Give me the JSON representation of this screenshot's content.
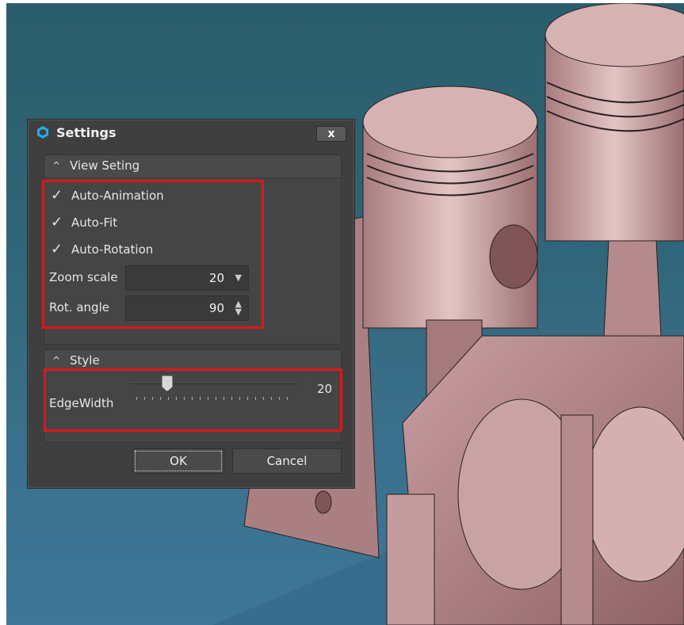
{
  "dialog": {
    "title": "Settings",
    "close_label": "x",
    "view_group": {
      "title": "View Seting",
      "checkboxes": [
        {
          "label": "Auto-Animation",
          "checked": true
        },
        {
          "label": "Auto-Fit",
          "checked": true
        },
        {
          "label": "Auto-Rotation",
          "checked": true
        }
      ],
      "zoom_label": "Zoom scale",
      "zoom_value": "20",
      "rot_label": "Rot. angle",
      "rot_value": "90"
    },
    "style_group": {
      "title": "Style",
      "edge_label": "EdgeWidth",
      "edge_value": "20"
    },
    "ok_label": "OK",
    "cancel_label": "Cancel"
  },
  "icons": {
    "chevron": "chevron-up-icon",
    "check": "checkmark-icon",
    "dropdown": "dropdown-arrow-icon",
    "spinner": "spinner-arrows-icon"
  },
  "colors": {
    "dialog_bg": "#3f3f3f",
    "highlight": "#e0151b",
    "model": "#c79a9c"
  }
}
